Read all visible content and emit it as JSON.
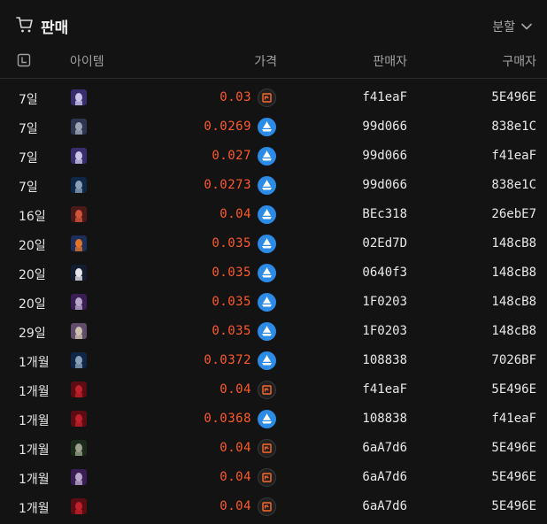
{
  "header": {
    "title": "판매",
    "split_label": "분할"
  },
  "columns": {
    "item": "아이템",
    "price": "가격",
    "seller": "판매자",
    "buyer": "구매자"
  },
  "colors": {
    "price": "#ff5a2a",
    "token_eth": "#2c8be6",
    "token_klay": "#1f1f1f"
  },
  "rows": [
    {
      "time": "7일",
      "thumb": "purple-house",
      "price": "0.03",
      "token": "klay-icon",
      "seller": "f41eaF",
      "buyer": "5E496E"
    },
    {
      "time": "7일",
      "thumb": "grey-blob",
      "price": "0.0269",
      "token": "eth-boat-icon",
      "seller": "99d066",
      "buyer": "838e1C"
    },
    {
      "time": "7일",
      "thumb": "purple-house",
      "price": "0.027",
      "token": "eth-boat-icon",
      "seller": "99d066",
      "buyer": "f41eaF"
    },
    {
      "time": "7일",
      "thumb": "dark-figure",
      "price": "0.0273",
      "token": "eth-boat-icon",
      "seller": "99d066",
      "buyer": "838e1C"
    },
    {
      "time": "16일",
      "thumb": "red-cat",
      "price": "0.04",
      "token": "eth-boat-icon",
      "seller": "BEc318",
      "buyer": "26ebE7"
    },
    {
      "time": "20일",
      "thumb": "orange-figure",
      "price": "0.035",
      "token": "eth-boat-icon",
      "seller": "02Ed7D",
      "buyer": "148cB8"
    },
    {
      "time": "20일",
      "thumb": "white-ghost",
      "price": "0.035",
      "token": "eth-boat-icon",
      "seller": "0640f3",
      "buyer": "148cB8"
    },
    {
      "time": "20일",
      "thumb": "violet-figure",
      "price": "0.035",
      "token": "eth-boat-icon",
      "seller": "1F0203",
      "buyer": "148cB8"
    },
    {
      "time": "29일",
      "thumb": "tan-figure",
      "price": "0.035",
      "token": "eth-boat-icon",
      "seller": "1F0203",
      "buyer": "148cB8"
    },
    {
      "time": "1개월",
      "thumb": "dark-figure",
      "price": "0.0372",
      "token": "eth-boat-icon",
      "seller": "108838",
      "buyer": "7026BF"
    },
    {
      "time": "1개월",
      "thumb": "red-figure",
      "price": "0.04",
      "token": "klay-icon",
      "seller": "f41eaF",
      "buyer": "5E496E"
    },
    {
      "time": "1개월",
      "thumb": "red-figure",
      "price": "0.0368",
      "token": "eth-boat-icon",
      "seller": "108838",
      "buyer": "f41eaF"
    },
    {
      "time": "1개월",
      "thumb": "olive-figure",
      "price": "0.04",
      "token": "klay-icon",
      "seller": "6aA7d6",
      "buyer": "5E496E"
    },
    {
      "time": "1개월",
      "thumb": "violet-figure",
      "price": "0.04",
      "token": "klay-icon",
      "seller": "6aA7d6",
      "buyer": "5E496E"
    },
    {
      "time": "1개월",
      "thumb": "red-figure",
      "price": "0.04",
      "token": "klay-icon",
      "seller": "6aA7d6",
      "buyer": "5E496E"
    }
  ]
}
